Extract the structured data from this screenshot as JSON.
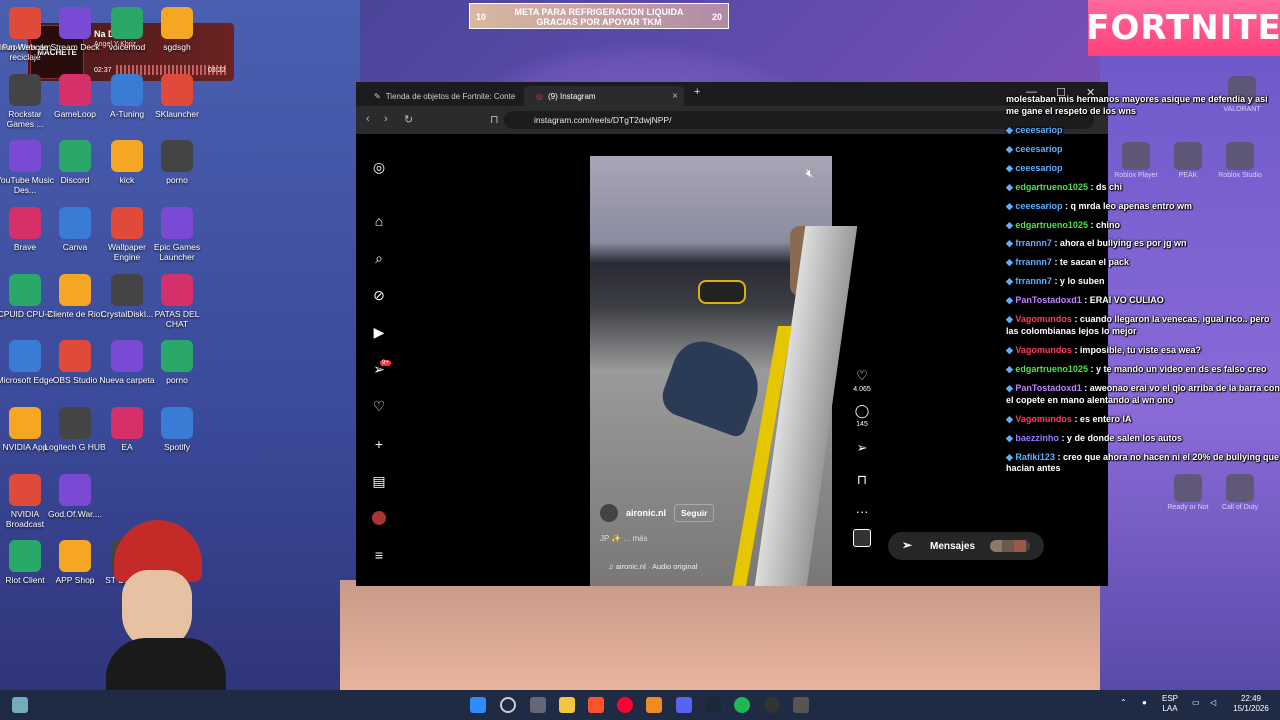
{
  "banner": {
    "left": "10",
    "text": "META PARA REFRIGERACION LIQUIDA GRACIAS POR APOYAR TKM",
    "right": "20"
  },
  "brand": {
    "fortnite": "FORTNITE"
  },
  "music": {
    "cover": "MACHETE",
    "song": "Na De Na",
    "artist": "Angel Y Khriz",
    "elapsed": "02:37",
    "total": "03:22"
  },
  "desktop": [
    {
      "label": "Papelera de reciclaje",
      "icon": "recycle-bin-icon"
    },
    {
      "label": "Iriun Webcam",
      "icon": "webcam-icon"
    },
    {
      "label": "Stream Deck",
      "icon": "stream-deck-icon"
    },
    {
      "label": "voicemod",
      "icon": "folder-icon"
    },
    {
      "label": "sgdsgh",
      "icon": "image-icon"
    },
    {
      "label": "Rockstar Games ...",
      "icon": "rockstar-icon"
    },
    {
      "label": "GameLoop",
      "icon": "gameloop-icon"
    },
    {
      "label": "A-Tuning",
      "icon": "a-tuning-icon"
    },
    {
      "label": "SKlauncher",
      "icon": "sklauncher-icon"
    },
    {
      "label": "YouTube Music Des...",
      "icon": "youtube-music-icon"
    },
    {
      "label": "Discord",
      "icon": "discord-icon"
    },
    {
      "label": "kick",
      "icon": "folder-icon"
    },
    {
      "label": "porno",
      "icon": "winrar-icon"
    },
    {
      "label": "Brave",
      "icon": "brave-icon"
    },
    {
      "label": "Canva",
      "icon": "canva-icon"
    },
    {
      "label": "Wallpaper Engine",
      "icon": "wallpaper-engine-icon"
    },
    {
      "label": "Epic Games Launcher",
      "icon": "epic-games-icon"
    },
    {
      "label": "CPUID CPU-Z",
      "icon": "cpuz-icon"
    },
    {
      "label": "Cliente de Riot",
      "icon": "riot-icon"
    },
    {
      "label": "CrystalDiskI...",
      "icon": "crystaldisk-icon"
    },
    {
      "label": "PATAS DEL CHAT",
      "icon": "blank-icon"
    },
    {
      "label": "Microsoft Edge",
      "icon": "edge-icon"
    },
    {
      "label": "OBS Studio",
      "icon": "obs-icon"
    },
    {
      "label": "Nueva carpeta",
      "icon": "folder-icon"
    },
    {
      "label": "porno",
      "icon": "folder-icon"
    },
    {
      "label": "NVIDIA App",
      "icon": "nvidia-icon"
    },
    {
      "label": "Logitech G HUB",
      "icon": "logitech-icon"
    },
    {
      "label": "EA",
      "icon": "ea-icon"
    },
    {
      "label": "Spotify",
      "icon": "spotify-icon"
    },
    {
      "label": "NVIDIA Broadcast",
      "icon": "nvidia-broadcast-icon"
    },
    {
      "label": "God.Of.War....",
      "icon": "folder-icon"
    },
    {
      "label": "Riot Client",
      "icon": "riot-client-icon"
    },
    {
      "label": "APP Shop",
      "icon": "app-shop-icon"
    },
    {
      "label": "ST SCRE...",
      "icon": "screenshot-icon"
    }
  ],
  "browser": {
    "tabs": [
      {
        "title": "Tienda de objetos de Fortnite: Conte"
      },
      {
        "title": "(9) Instagram"
      }
    ],
    "url": "instagram.com/reels/DTgT2dwjNPP/",
    "new_tab": "+"
  },
  "instagram": {
    "notif_badge": "9+",
    "username": "aironic.nl",
    "follow": "Seguir",
    "caption": "JP ✨ ... más",
    "audio": "aironic.nl · Audio original",
    "likes": "4.065",
    "comments": "145",
    "messages": "Mensajes",
    "messages_badge": "9+"
  },
  "chat": [
    {
      "user": "",
      "text": "molestaban mis hermanos mayores asique me defendia y asi me gane el respeto de los wns",
      "color": "#fff"
    },
    {
      "user": "ceeesariop",
      "text": "",
      "color": "u-b"
    },
    {
      "user": "ceeesariop",
      "text": "",
      "color": "u-b"
    },
    {
      "user": "ceeesariop",
      "text": "",
      "color": "u-b"
    },
    {
      "user": "edgartrueno1025",
      "text": ": ds chi",
      "color": "u-g"
    },
    {
      "user": "ceeesariop",
      "text": ": q mrda leo apenas entro wm",
      "color": "u-b"
    },
    {
      "user": "edgartrueno1025",
      "text": ": chino",
      "color": "u-g"
    },
    {
      "user": "frrannn7",
      "text": ": ahora el bullying es por jg wn",
      "color": "u-b"
    },
    {
      "user": "frrannn7",
      "text": ": te sacan el pack",
      "color": "u-b"
    },
    {
      "user": "frrannn7",
      "text": ": y lo suben",
      "color": "u-b"
    },
    {
      "user": "PanTostadoxd1",
      "text": ": ERAI VO CULIAO",
      "color": "u-p"
    },
    {
      "user": "Vagomundos",
      "text": ": cuando llegaron la venecas, igual rico.. pero las colombianas lejos lo mejor",
      "color": "u-r"
    },
    {
      "user": "Vagomundos",
      "text": ": imposible, tu viste esa wea?",
      "color": "u-r"
    },
    {
      "user": "edgartrueno1025",
      "text": ": y te mando un video en ds es falso creo",
      "color": "u-g"
    },
    {
      "user": "PanTostadoxd1",
      "text": ": aweonao erai vo el qlo arriba de la barra con el copete en mano alentando al wn ono",
      "color": "u-p"
    },
    {
      "user": "Vagomundos",
      "text": ": es entero IA",
      "color": "u-r"
    },
    {
      "user": "baezzinho",
      "text": ": y de donde salen los autos",
      "color": "u-m"
    },
    {
      "user": "Rafiki123",
      "text": ": creo que ahora no hacen ni el 20% de bullying que hacian antes",
      "color": "u-b"
    }
  ],
  "right_apps": [
    {
      "label": "Roblox Player",
      "icon": "roblox-icon"
    },
    {
      "label": "PEAK",
      "icon": "peak-icon"
    },
    {
      "label": "Roblox Studio",
      "icon": "roblox-studio-icon"
    },
    {
      "label": "VALORANT",
      "icon": "valorant-icon"
    },
    {
      "label": "Ready or Not",
      "icon": "ready-or-not-icon"
    },
    {
      "label": "Call of Duty",
      "icon": "cod-icon"
    }
  ],
  "tray": {
    "lang": "ESP",
    "layout": "LAA",
    "time": "22:49",
    "date": "15/1/2026"
  }
}
